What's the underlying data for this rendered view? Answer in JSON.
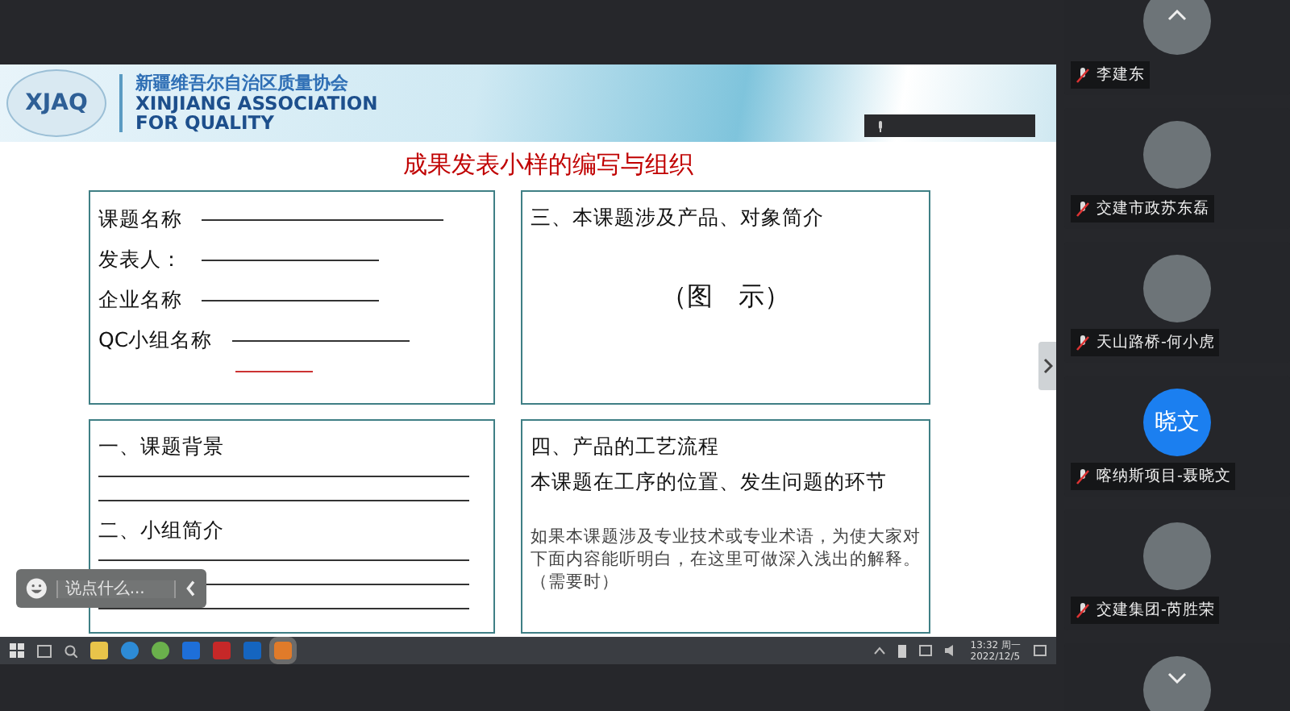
{
  "slide": {
    "org_name_cn": "新疆维吾尔自治区质量协会",
    "org_name_en_1": "XINJIANG ASSOCIATION",
    "org_name_en_2": "FOR QUALITY",
    "logo_text": "XJAQ",
    "title": "成果发表小样的编写与组织",
    "boxes": [
      {
        "kind": "form",
        "fields": [
          "课题名称",
          "发表人：",
          "企业名称",
          "QC小组名称"
        ]
      },
      {
        "kind": "figure",
        "heading": "三、本课题涉及产品、对象简介",
        "figure_label": "（图　示）"
      },
      {
        "kind": "sections",
        "sections": [
          "一、课题背景",
          "二、小组简介"
        ]
      },
      {
        "kind": "process",
        "heading": "四、产品的工艺流程",
        "subheading": "本课题在工序的位置、发生问题的环节",
        "note": "如果本课题涉及专业技术或专业术语，为使大家对下面内容能听明白，在这里可做深入浅出的解释。（需要时）"
      }
    ]
  },
  "chat": {
    "placeholder": "说点什么..."
  },
  "taskbar": {
    "time": "13:32 周一",
    "date": "2022/12/5"
  },
  "participants": [
    {
      "name": "李建东"
    },
    {
      "name": "交建市政苏东磊"
    },
    {
      "name": "天山路桥-何小虎"
    },
    {
      "name": "喀纳斯项目-聂晓文",
      "avatar_text": "晓文"
    },
    {
      "name": "交建集团-芮胜荣"
    }
  ]
}
